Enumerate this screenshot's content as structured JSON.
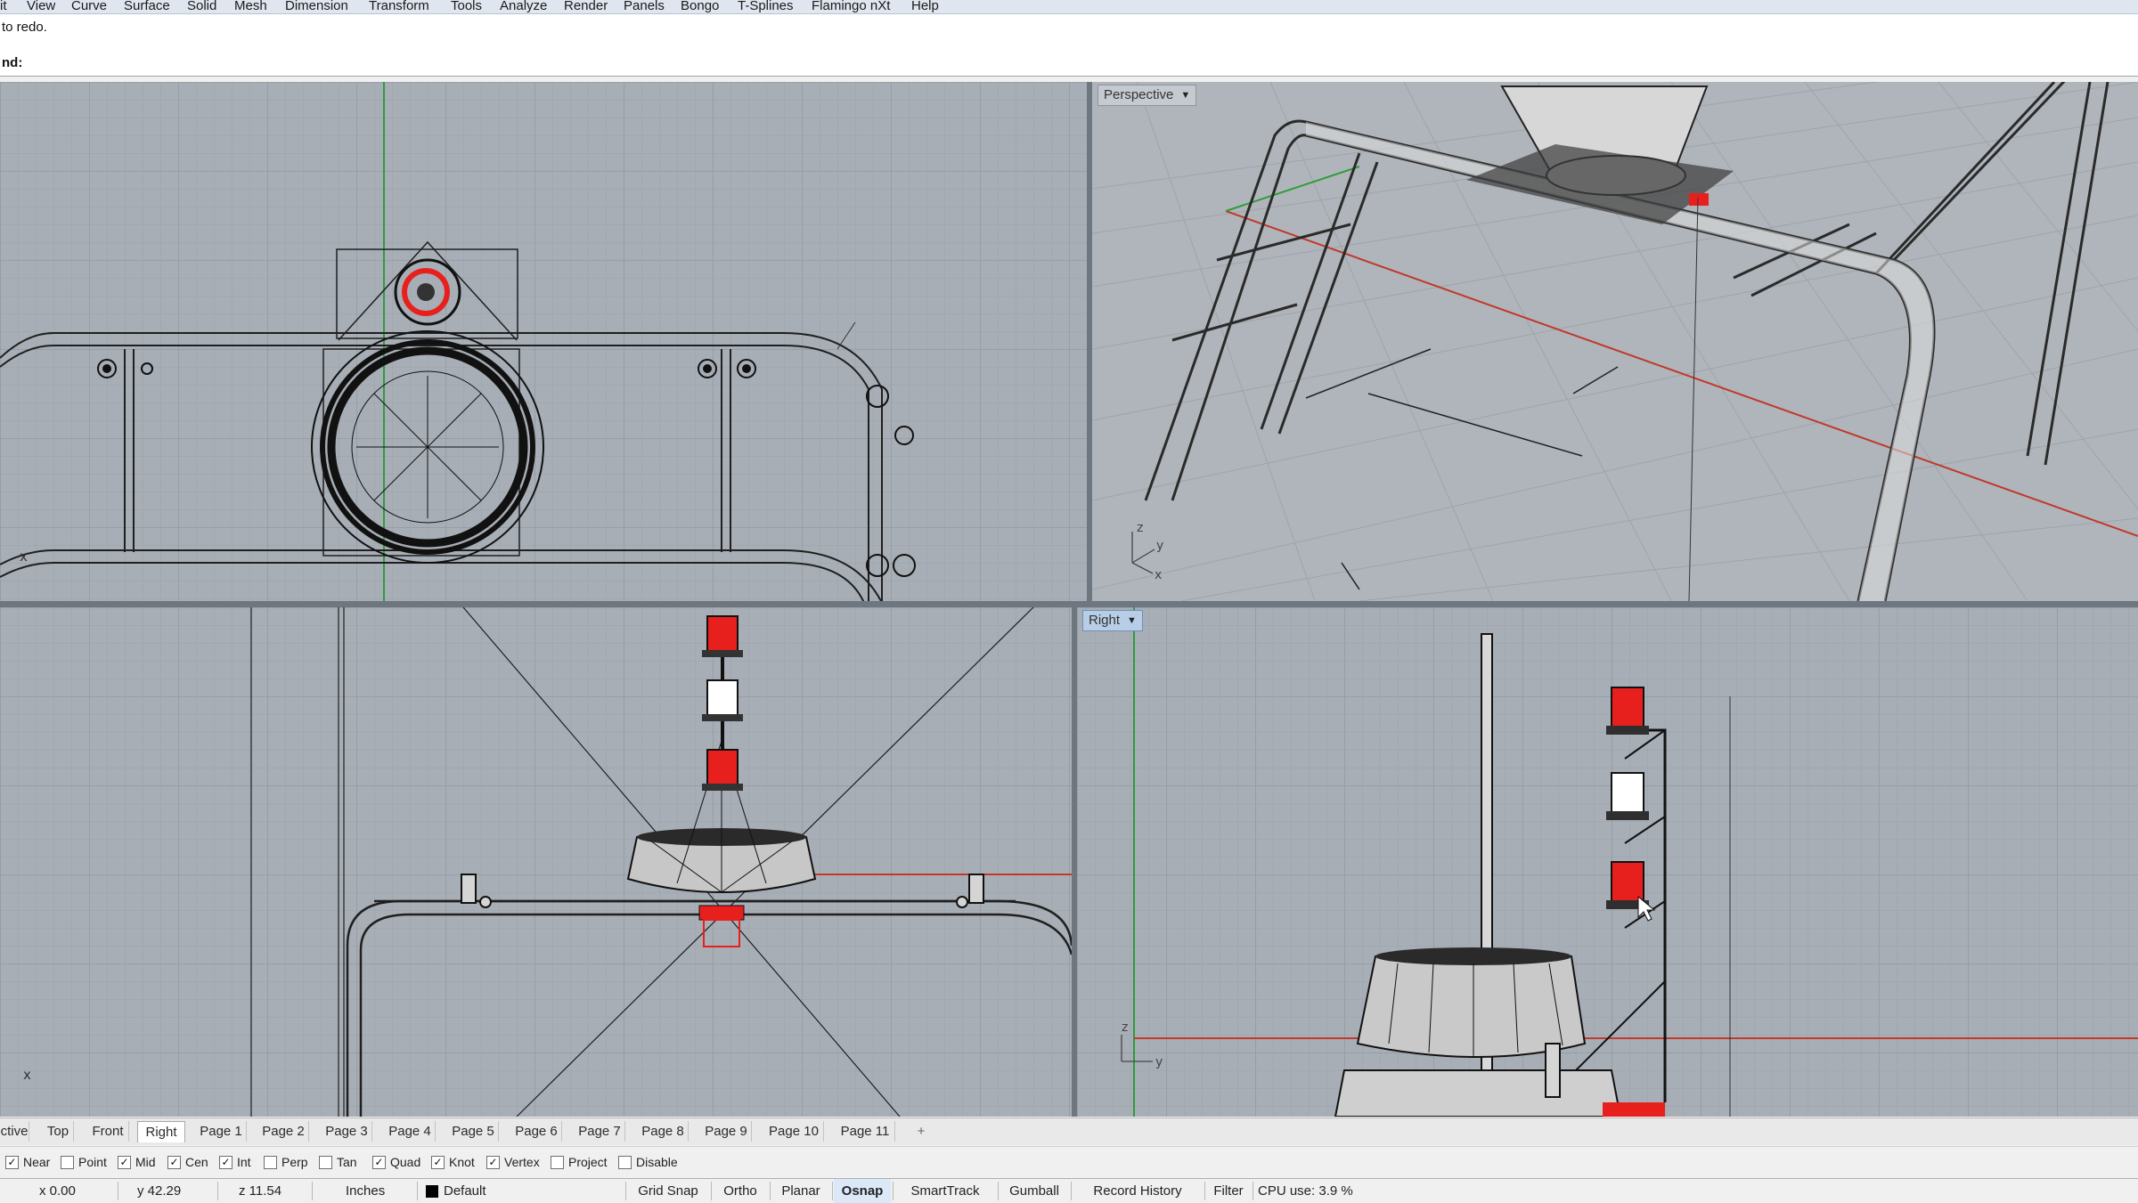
{
  "menu": [
    "it",
    "View",
    "Curve",
    "Surface",
    "Solid",
    "Mesh",
    "Dimension",
    "Transform",
    "Tools",
    "Analyze",
    "Render",
    "Panels",
    "Bongo",
    "T-Splines",
    "Flamingo nXt",
    "Help"
  ],
  "command_history": {
    "line": "to redo."
  },
  "command_line": {
    "prompt": "nd:",
    "value": ""
  },
  "viewports": {
    "top": {
      "axis_label": "x"
    },
    "perspective": {
      "label": "Perspective",
      "axis_x": "x",
      "axis_y": "y",
      "axis_z": "z"
    },
    "front": {
      "axis_label": "x"
    },
    "right": {
      "label": "Right",
      "axis_y": "y",
      "axis_z": "z"
    }
  },
  "layout_tabs": [
    "ctive",
    "Top",
    "Front",
    "Right",
    "Page 1",
    "Page 2",
    "Page 3",
    "Page 4",
    "Page 5",
    "Page 6",
    "Page 7",
    "Page 8",
    "Page 9",
    "Page 10",
    "Page 11"
  ],
  "active_tab": "Right",
  "add_tab_symbol": "+",
  "osnaps": [
    {
      "label": "Near",
      "checked": true
    },
    {
      "label": "Point",
      "checked": false
    },
    {
      "label": "Mid",
      "checked": true
    },
    {
      "label": "Cen",
      "checked": true
    },
    {
      "label": "Int",
      "checked": true
    },
    {
      "label": "Perp",
      "checked": false
    },
    {
      "label": "Tan",
      "checked": false
    },
    {
      "label": "Quad",
      "checked": true
    },
    {
      "label": "Knot",
      "checked": true
    },
    {
      "label": "Vertex",
      "checked": true
    },
    {
      "label": "Project",
      "checked": false
    },
    {
      "label": "Disable",
      "checked": false
    }
  ],
  "status": {
    "x": "x 0.00",
    "y": "y 42.29",
    "z": "z 11.54",
    "units": "Inches",
    "layer": "Default",
    "layer_color": "#000000",
    "panes": [
      {
        "label": "Grid Snap",
        "on": false
      },
      {
        "label": "Ortho",
        "on": false
      },
      {
        "label": "Planar",
        "on": false
      },
      {
        "label": "Osnap",
        "on": true
      },
      {
        "label": "SmartTrack",
        "on": false
      },
      {
        "label": "Gumball",
        "on": false
      },
      {
        "label": "Record History",
        "on": false
      },
      {
        "label": "Filter",
        "on": false
      }
    ],
    "cpu": "CPU use: 3.9 %"
  },
  "colors": {
    "viewport_bg": "#a8aeb6",
    "grid": "#9ba1a9",
    "x_axis": "#c0392b",
    "y_axis": "#2e9c3a",
    "light_red": "#e8201d"
  }
}
